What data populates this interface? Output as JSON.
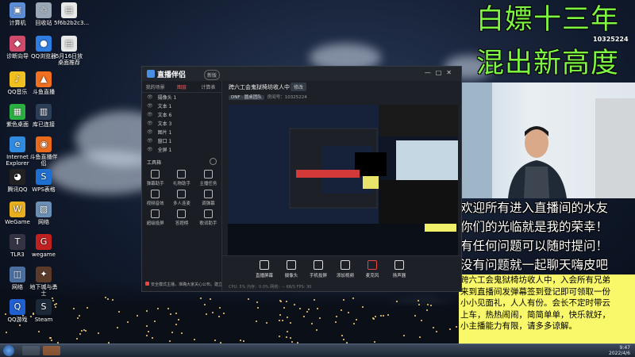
{
  "desktop": {
    "icons": [
      {
        "label": "计算机",
        "color": "#5b8ed6",
        "glyph": "▣"
      },
      {
        "label": "回收站",
        "color": "#9aa7b6",
        "glyph": "♲"
      },
      {
        "label": "5f6b2b2c3...",
        "color": "#e8e8e8",
        "glyph": "▤"
      },
      {
        "label": "诊断向导",
        "color": "#d04a6b",
        "glyph": "◆"
      },
      {
        "label": "QQ浏览器",
        "color": "#2f7de1",
        "glyph": "●"
      },
      {
        "label": "5月16日放桌面推荐",
        "color": "#e8e8e8",
        "glyph": "▤"
      },
      {
        "label": "QQ音乐",
        "color": "#f0c020",
        "glyph": "♪"
      },
      {
        "label": "斗鱼直播",
        "color": "#f07020",
        "glyph": "▲"
      },
      {
        "label": "紫色桌面",
        "color": "#2ab040",
        "glyph": "▦"
      },
      {
        "label": "库已连接",
        "color": "#2c3e58",
        "glyph": "▥"
      },
      {
        "label": "Internet Explorer",
        "color": "#2f8ae0",
        "glyph": "e"
      },
      {
        "label": "斗鱼直播伴侣",
        "color": "#e86a1a",
        "glyph": "◉"
      },
      {
        "label": "腾讯QQ",
        "color": "#222",
        "glyph": "◕"
      },
      {
        "label": "WPS表格",
        "color": "#1f6fd1",
        "glyph": "S"
      },
      {
        "label": "WeGame",
        "color": "#e8b020",
        "glyph": "W"
      },
      {
        "label": "网络",
        "color": "#6b8fb5",
        "glyph": "▧"
      },
      {
        "label": "TLR3",
        "color": "#334",
        "glyph": "T"
      },
      {
        "label": "wegame",
        "color": "#c02020",
        "glyph": "G"
      },
      {
        "label": "网络",
        "color": "#4a6fa0",
        "glyph": "◫"
      },
      {
        "label": "地下城与勇士",
        "color": "#5b3a2a",
        "glyph": "✦"
      },
      {
        "label": "QQ游戏",
        "color": "#1f5fd0",
        "glyph": "Q"
      },
      {
        "label": "Steam",
        "color": "#1b2838",
        "glyph": "S"
      }
    ]
  },
  "overlay": {
    "title_line1": "白嫖十三年",
    "title_line2": "混出新高度",
    "room_id": "10325224",
    "welcome_lines": [
      "欢迎所有进入直播间的水友",
      "你们的光临就是我的荣幸！",
      "有任何问题可以随时提问！",
      "没有问题就一起聊天嗨皮吧"
    ],
    "notice_lines": [
      "跨六工会鬼狱椅坊收人中，入会所有兄弟",
      "来到直播间发弹幕签到登记即可领取一份",
      "小小见面礼，人人有份。会长不定时带云",
      "上车，热热闹闹，简简单单，快乐就好，",
      "小主播能力有限，请多多谅解。"
    ]
  },
  "app": {
    "logo": "直播伴侣",
    "version": "新版",
    "tabs": [
      "我的场景",
      "图层",
      "计算表"
    ],
    "active_tab": 1,
    "scenes": [
      "摄像头 1",
      "文本 1",
      "文本 6",
      "文本 3",
      "图片 1",
      "窗口 1",
      "全屏 1"
    ],
    "tools_title": "工具箱",
    "tools": [
      "弹幕助手",
      "礼物助手",
      "主播任务",
      "视频音效",
      "多人连麦",
      "调弹幕",
      "超级投屏",
      "答题榜",
      "歌词助手"
    ],
    "stream_title": "跨六工会鬼狱椅坊收人中",
    "edit_label": "修改",
    "stream_info_tag": "DNF · 圆桌团队",
    "stream_info": "房间号：10325224",
    "bottom_buttons": [
      "直播屏幕",
      "摄像头",
      "手机投屏",
      "添加视频",
      "麦克风",
      "扬声器"
    ],
    "tip_text": "安全模式主播，准确大家关心公布。建立原创作品数据库",
    "status_text": "CPU: 5%  内存：0.0%  网络：-- KB/S  FPS: 30"
  },
  "taskbar": {
    "time": "9:47",
    "date": "2022/4/6"
  }
}
